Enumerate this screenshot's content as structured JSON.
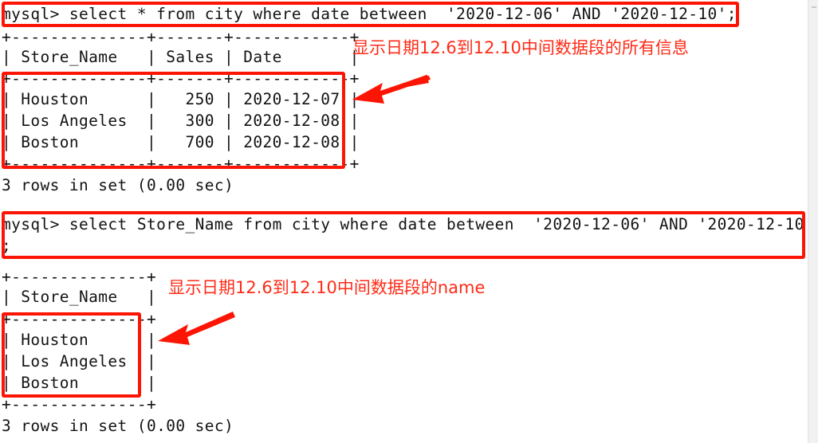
{
  "meta": {
    "app": "mysql-client-terminal",
    "colors": {
      "annotation_red": "#fc1505",
      "note_red": "#fe2b17",
      "terminal_text": "#131313",
      "background": "#ffffff",
      "gutter": "#f1f1f1"
    }
  },
  "terminal": {
    "block1": {
      "prompt_line": "mysql> select * from city where date between  '2020-12-06' AND '2020-12-10';",
      "sep_top": "+--------------+-------+------------+",
      "header_row": "| Store_Name   | Sales | Date       |",
      "sep_mid": "+--------------+-------+------------+",
      "rows": [
        "| Houston      |   250 | 2020-12-07 |",
        "| Los Angeles  |   300 | 2020-12-08 |",
        "| Boston       |   700 | 2020-12-08 |"
      ],
      "sep_bottom": "+--------------+-------+------------+",
      "status": "3 rows in set (0.00 sec)",
      "table": {
        "columns": [
          "Store_Name",
          "Sales",
          "Date"
        ],
        "data": [
          [
            "Houston",
            "250",
            "2020-12-07"
          ],
          [
            "Los Angeles",
            "300",
            "2020-12-08"
          ],
          [
            "Boston",
            "700",
            "2020-12-08"
          ]
        ],
        "row_count": "3 rows"
      }
    },
    "block2": {
      "prompt_line_1": "mysql> select Store_Name from city where date between  '2020-12-06' AND '2020-12-10'",
      "prompt_line_2": ";",
      "sep_top": "+--------------+",
      "header_row": "| Store_Name   |",
      "sep_mid": "+--------------+",
      "rows": [
        "| Houston      |",
        "| Los Angeles  |",
        "| Boston       |"
      ],
      "sep_bottom": "+--------------+",
      "status": "3 rows in set (0.00 sec)",
      "table": {
        "columns": [
          "Store_Name"
        ],
        "data": [
          [
            "Houston"
          ],
          [
            "Los Angeles"
          ],
          [
            "Boston"
          ]
        ],
        "row_count": "3 rows"
      }
    }
  },
  "annotations": {
    "note1": "显示日期12.6到12.10中间数据段的所有信息",
    "note2": "显示日期12.6到12.10中间数据段的name"
  }
}
